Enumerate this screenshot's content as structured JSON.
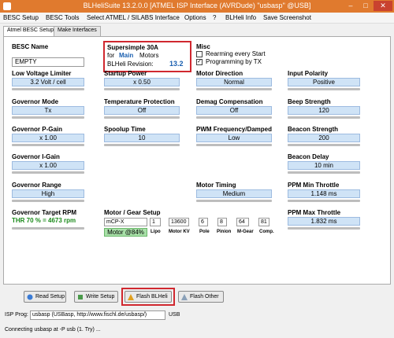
{
  "window": {
    "title": "BLHeliSuite 13.2.0.0  [ATMEL ISP Interface (AVRDude) \"usbasp\" @USB]",
    "minimize": "–",
    "maximize": "□",
    "close": "✕"
  },
  "menu": [
    "BESC Setup",
    "BESC Tools",
    "Select ATMEL / SILABS Interface",
    "Options",
    "?",
    "BLHeli Info",
    "Save Screenshot"
  ],
  "tabs": [
    "Atmel BESC Setup",
    "Make Interfaces"
  ],
  "besc_name": {
    "label": "BESC Name",
    "value": "EMPTY"
  },
  "info": {
    "line1": "Supersimple 30A",
    "line2_a": "for",
    "line2_b": "Main",
    "line2_c": "Motors",
    "line3": "BLHeli Revision:",
    "revision": "13.2"
  },
  "misc": {
    "label": "Misc",
    "rearming": "Rearming every Start",
    "rearming_checked": false,
    "programming": "Programming by TX",
    "programming_checked": true
  },
  "params": {
    "low_voltage": {
      "label": "Low Voltage Limiter",
      "value": "3.2 Volt / cell"
    },
    "startup_power": {
      "label": "Startup Power",
      "value": "x 0.50"
    },
    "motor_direction": {
      "label": "Motor Direction",
      "value": "Normal"
    },
    "input_polarity": {
      "label": "Input Polarity",
      "value": "Positive"
    },
    "governor_mode": {
      "label": "Governor Mode",
      "value": "Tx"
    },
    "temp_protection": {
      "label": "Temperature Protection",
      "value": "Off"
    },
    "demag": {
      "label": "Demag Compensation",
      "value": "Off"
    },
    "beep_strength": {
      "label": "Beep Strength",
      "value": "120"
    },
    "gov_p": {
      "label": "Governor P-Gain",
      "value": "x 1.00"
    },
    "spoolup": {
      "label": "Spoolup Time",
      "value": "10"
    },
    "pwm_freq": {
      "label": "PWM Frequency/Damped",
      "value": "Low"
    },
    "beacon_strength": {
      "label": "Beacon Strength",
      "value": "200"
    },
    "gov_i": {
      "label": "Governor I-Gain",
      "value": "x 1.00"
    },
    "beacon_delay": {
      "label": "Beacon Delay",
      "value": "10 min"
    },
    "gov_range": {
      "label": "Governor Range",
      "value": "High"
    },
    "motor_timing": {
      "label": "Motor Timing",
      "value": "Medium"
    },
    "ppm_min": {
      "label": "PPM Min Throttle",
      "value": "1.148 ms"
    },
    "ppm_max": {
      "label": "PPM Max Throttle",
      "value": "1.832 ms"
    }
  },
  "gov_target": {
    "label": "Governor Target RPM",
    "value": "THR 70 % = 4673 rpm"
  },
  "motor_gear": {
    "label": "Motor / Gear Setup",
    "motor": "mCP-X",
    "lipo": "1",
    "kv": "13600",
    "pole": "6",
    "pinion": "8",
    "mgear": "64",
    "comp": "81",
    "cap_lipo": "Lipo",
    "cap_kv": "Motor KV",
    "cap_pole": "Pole",
    "cap_pinion": "Pinion",
    "cap_mgear": "M-Gear",
    "cap_comp": "Comp.",
    "motor_load": "Motor @84%"
  },
  "buttons": {
    "read": "Read Setup",
    "write": "Write Setup",
    "flash_blheli": "Flash BLHeli",
    "flash_other": "Flash Other"
  },
  "isp": {
    "label": "ISP Prog:",
    "value": "usbasp (USBasp, http://www.fischl.de/usbasp/)",
    "port": "USB"
  },
  "status": "Connecting usbasp at -P usb (1. Try) ...",
  "colors": {
    "accent": "#e07a2e",
    "field": "#cfe3f6",
    "highlight": "#d0282f",
    "green": "#1a8a1a",
    "blue_text": "#1a5fb0"
  }
}
